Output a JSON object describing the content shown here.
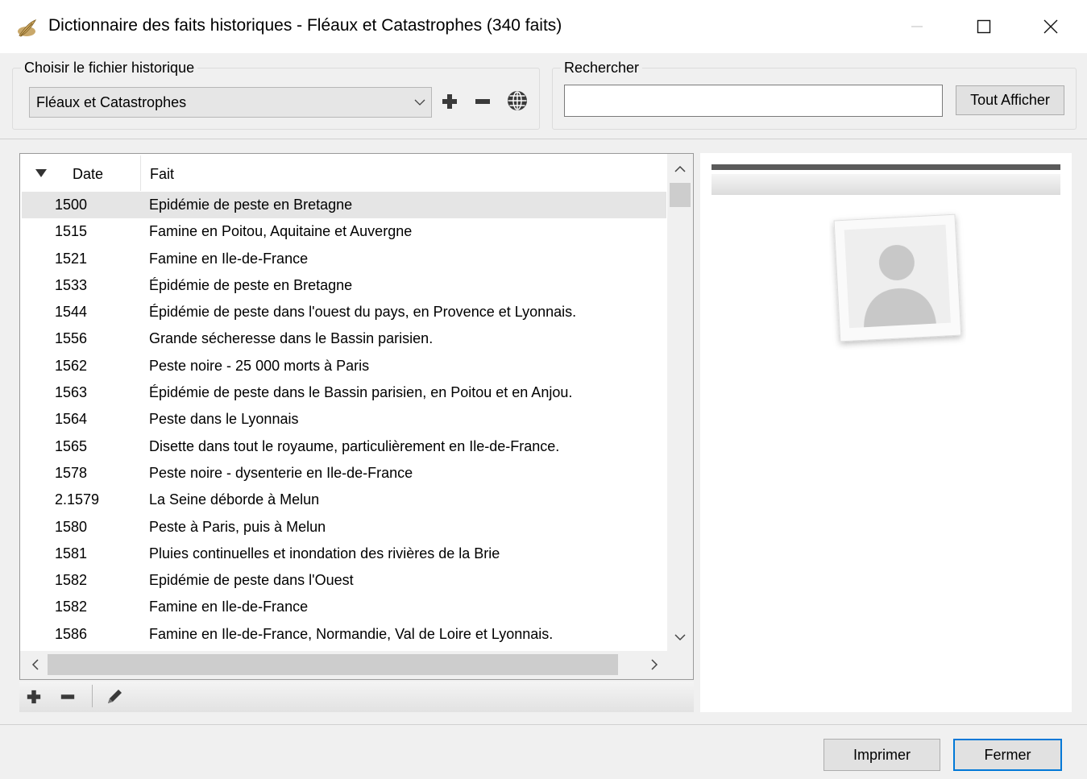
{
  "window": {
    "title": "Dictionnaire des faits historiques - Fléaux et Catastrophes (340 faits)"
  },
  "file_group": {
    "label": "Choisir le fichier historique",
    "selected_file": "Fléaux et Catastrophes"
  },
  "search_group": {
    "label": "Rechercher",
    "query": "",
    "show_all_label": "Tout Afficher"
  },
  "table": {
    "columns": [
      "Date",
      "Fait"
    ],
    "sort_indicator": "descending-arrow",
    "selected_index": 0,
    "rows": [
      {
        "date": "1500",
        "fait": "Epidémie de peste en Bretagne"
      },
      {
        "date": "1515",
        "fait": "Famine en Poitou, Aquitaine et Auvergne"
      },
      {
        "date": "1521",
        "fait": "Famine en Ile-de-France"
      },
      {
        "date": "1533",
        "fait": "Épidémie de peste en Bretagne"
      },
      {
        "date": "1544",
        "fait": "Épidémie de peste dans l'ouest du pays, en Provence et Lyonnais."
      },
      {
        "date": "1556",
        "fait": "Grande sécheresse dans le Bassin parisien."
      },
      {
        "date": "1562",
        "fait": "Peste noire - 25 000 morts à Paris"
      },
      {
        "date": "1563",
        "fait": "Épidémie de peste dans le Bassin parisien, en Poitou et en Anjou."
      },
      {
        "date": "1564",
        "fait": "Peste dans le Lyonnais"
      },
      {
        "date": "1565",
        "fait": "Disette dans tout le royaume, particulièrement en Ile-de-France."
      },
      {
        "date": "1578",
        "fait": "Peste noire - dysenterie en Ile-de-France"
      },
      {
        "date": "2.1579",
        "fait": "La Seine déborde à Melun"
      },
      {
        "date": "1580",
        "fait": "Peste à Paris, puis à Melun"
      },
      {
        "date": "1581",
        "fait": "Pluies continuelles et inondation des rivières de la Brie"
      },
      {
        "date": "1582",
        "fait": "Epidémie de peste dans l'Ouest"
      },
      {
        "date": "1582",
        "fait": "Famine en Ile-de-France"
      },
      {
        "date": "1586",
        "fait": "Famine en Ile-de-France, Normandie, Val de Loire et Lyonnais."
      }
    ]
  },
  "buttons": {
    "print": "Imprimer",
    "close": "Fermer"
  },
  "icons": {
    "app": "quill-icon",
    "add": "plus-icon",
    "remove": "minus-icon",
    "web": "globe-icon",
    "edit": "pencil-icon",
    "photo": "person-placeholder-icon"
  },
  "colors": {
    "window_bg": "#f0f0f0",
    "selected_row": "#e5e5e5",
    "default_button_border": "#0078d7"
  }
}
